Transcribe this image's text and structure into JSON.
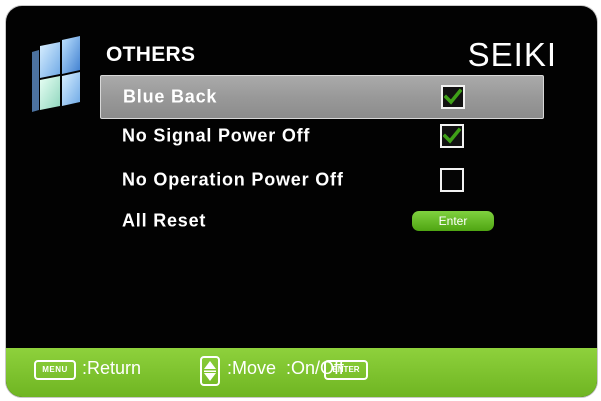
{
  "header": {
    "section_title": "OTHERS",
    "brand": "SEIKI"
  },
  "menu": {
    "items": [
      {
        "label": "Blue Back",
        "control": "checkbox",
        "checked": true,
        "selected": true
      },
      {
        "label": "No Signal Power Off",
        "control": "checkbox",
        "checked": true,
        "selected": false
      },
      {
        "label": "No Operation Power Off",
        "control": "checkbox",
        "checked": false,
        "selected": false
      },
      {
        "label": "All Reset",
        "control": "button",
        "button_label": "Enter",
        "selected": false
      }
    ]
  },
  "footer": {
    "menu_key": "MENU",
    "return_label": ":Return",
    "move_label": ":Move",
    "onoff_label": ":On/Off",
    "enter_key": "ENTER"
  },
  "colors": {
    "background": "#020202",
    "accent_green": "#7fc22f",
    "selection_gray": "#9a9a9a",
    "check_green": "#3fa018"
  },
  "icons": {
    "logo": "picture-tiles-icon",
    "check": "checkmark-icon",
    "updown": "up-down-arrows-icon"
  }
}
